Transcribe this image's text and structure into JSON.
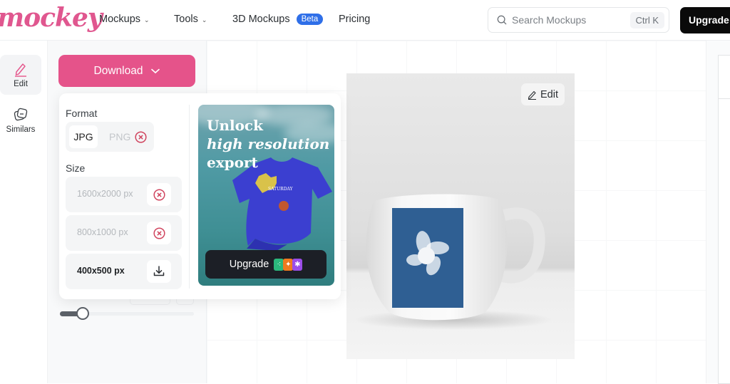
{
  "header": {
    "logo": "mockey",
    "nav": [
      {
        "label": "Mockups",
        "has_dropdown": true
      },
      {
        "label": "Tools",
        "has_dropdown": true
      },
      {
        "label": "3D Mockups",
        "badge": "Beta"
      },
      {
        "label": "Pricing"
      }
    ],
    "search": {
      "placeholder": "Search Mockups",
      "value": "",
      "shortcut": "Ctrl K",
      "icon": "search-icon"
    },
    "upgrade_label": "Upgrade"
  },
  "sidebar": {
    "items": [
      {
        "label": "Edit",
        "icon": "pencil-icon",
        "active": true
      },
      {
        "label": "Similars",
        "icon": "layers-icon",
        "active": false
      }
    ]
  },
  "panel": {
    "download_label": "Download",
    "slider_value": 0.17
  },
  "download_menu": {
    "format_label": "Format",
    "formats": [
      {
        "label": "JPG",
        "selected": true,
        "locked": false
      },
      {
        "label": "PNG",
        "selected": false,
        "locked": true
      }
    ],
    "size_label": "Size",
    "sizes": [
      {
        "label": "1600x2000 px",
        "locked": true,
        "action_icon": "x-circle-icon"
      },
      {
        "label": "800x1000 px",
        "locked": true,
        "action_icon": "x-circle-icon"
      },
      {
        "label": "400x500 px",
        "locked": false,
        "action_icon": "download-icon"
      }
    ],
    "promo": {
      "line1": "Unlock",
      "line2": "high resolution",
      "line3": "export",
      "button_label": "Upgrade",
      "tiles": [
        {
          "glyph": "⁖",
          "color": "#2bb77c"
        },
        {
          "glyph": "✦",
          "color": "#f07a1e"
        },
        {
          "glyph": "✱",
          "color": "#9b4de8"
        }
      ]
    }
  },
  "canvas": {
    "edit_label": "Edit",
    "mockup_subject": "white mug with blue flower print"
  },
  "colors": {
    "brand_pink": "#e5538a",
    "beta_blue": "#2f6fe8",
    "locked_red": "#d0455f"
  }
}
